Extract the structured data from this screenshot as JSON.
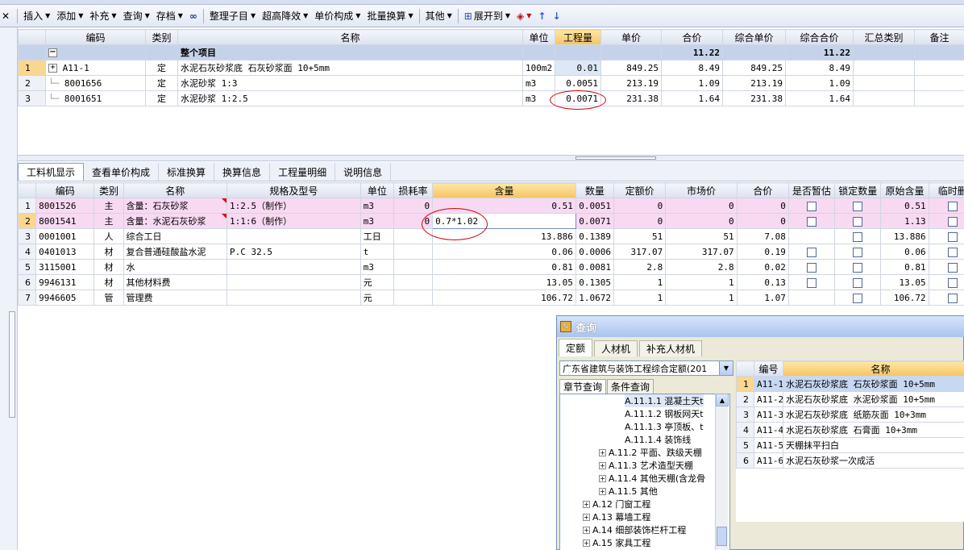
{
  "toolbar": {
    "insert": "插入",
    "add": "添加",
    "supplement": "补充",
    "query": "查询",
    "archive": "存档",
    "organize_children": "整理子目",
    "super_height": "超高降效",
    "unit_price_composition": "单价构成",
    "batch_conversion": "批量换算",
    "other": "其他",
    "expand_to": "展开到"
  },
  "upper_table": {
    "headers": [
      "编码",
      "类别",
      "名称",
      "单位",
      "工程量",
      "单价",
      "合价",
      "综合单价",
      "综合合价",
      "汇总类别",
      "备注"
    ],
    "summary_row": {
      "toggle": "−",
      "name": "整个项目",
      "total": "11.22",
      "comprehensive_total": "11.22"
    },
    "rows": [
      {
        "no": "1",
        "code": "A11-1",
        "type": "定",
        "name": "水泥石灰砂浆底 石灰砂浆面 10+5mm",
        "unit": "100m2",
        "qty": "0.01",
        "price": "849.25",
        "total": "8.49",
        "comp_price": "849.25",
        "comp_total": "8.49"
      },
      {
        "no": "2",
        "code": "8001656",
        "type": "定",
        "name": "水泥砂浆 1:3",
        "unit": "m3",
        "qty": "0.0051",
        "price": "213.19",
        "total": "1.09",
        "comp_price": "213.19",
        "comp_total": "1.09"
      },
      {
        "no": "3",
        "code": "8001651",
        "type": "定",
        "name": "水泥砂浆 1:2.5",
        "unit": "m3",
        "qty": "0.0071",
        "price": "231.38",
        "total": "1.64",
        "comp_price": "231.38",
        "comp_total": "1.64"
      }
    ]
  },
  "tabs": [
    "工料机显示",
    "查看单价构成",
    "标准换算",
    "换算信息",
    "工程量明细",
    "说明信息"
  ],
  "lower_table": {
    "headers": [
      "编码",
      "类别",
      "名称",
      "规格及型号",
      "单位",
      "损耗率",
      "含量",
      "数量",
      "定额价",
      "市场价",
      "合价",
      "是否暂估",
      "锁定数量",
      "原始含量",
      "临时删"
    ],
    "rows": [
      {
        "no": "1",
        "code": "8001526",
        "type": "主",
        "name": "含量：石灰砂浆",
        "spec": "1:2.5（制作）",
        "unit": "m3",
        "loss": "0",
        "content": "0.51",
        "qty": "0.0051",
        "quota": "0",
        "market": "0",
        "total": "0",
        "orig": "0.51"
      },
      {
        "no": "2",
        "code": "8001541",
        "type": "主",
        "name": "含量：水泥石灰砂浆",
        "spec": "1:1:6（制作）",
        "unit": "m3",
        "loss": "0",
        "content": "0.7*1.02",
        "qty": "0.0071",
        "quota": "0",
        "market": "0",
        "total": "0",
        "orig": "1.13"
      },
      {
        "no": "3",
        "code": "0001001",
        "type": "人",
        "name": "综合工日",
        "spec": "",
        "unit": "工日",
        "loss": "",
        "content": "13.886",
        "qty": "0.1389",
        "quota": "51",
        "market": "51",
        "total": "7.08",
        "orig": "13.886"
      },
      {
        "no": "4",
        "code": "0401013",
        "type": "材",
        "name": "复合普通硅酸盐水泥",
        "spec": "P.C 32.5",
        "unit": "t",
        "loss": "",
        "content": "0.06",
        "qty": "0.0006",
        "quota": "317.07",
        "market": "317.07",
        "total": "0.19",
        "orig": "0.06"
      },
      {
        "no": "5",
        "code": "3115001",
        "type": "材",
        "name": "水",
        "spec": "",
        "unit": "m3",
        "loss": "",
        "content": "0.81",
        "qty": "0.0081",
        "quota": "2.8",
        "market": "2.8",
        "total": "0.02",
        "orig": "0.81"
      },
      {
        "no": "6",
        "code": "9946131",
        "type": "材",
        "name": "其他材料费",
        "spec": "",
        "unit": "元",
        "loss": "",
        "content": "13.05",
        "qty": "0.1305",
        "quota": "1",
        "market": "1",
        "total": "0.13",
        "orig": "13.05"
      },
      {
        "no": "7",
        "code": "9946605",
        "type": "管",
        "name": "管理费",
        "spec": "",
        "unit": "元",
        "loss": "",
        "content": "106.72",
        "qty": "1.0672",
        "quota": "1",
        "market": "1",
        "total": "1.07",
        "orig": "106.72"
      }
    ]
  },
  "query": {
    "title": "查询",
    "tabs": [
      "定额",
      "人材机",
      "补充人材机"
    ],
    "combo": "广东省建筑与装饰工程综合定额(201",
    "subtabs": [
      "章节查询",
      "条件查询"
    ],
    "tree": [
      "A.11.1.1 混凝土天t",
      "A.11.1.2 钢板网天t",
      "A.11.1.3 亭顶板、t",
      "A.11.1.4 装饰线",
      "A.11.2 平面、跌级天棚",
      "A.11.3 艺术造型天棚",
      "A.11.4 其他天棚(含龙骨",
      "A.11.5 其他",
      "A.12 门窗工程",
      "A.13 幕墙工程",
      "A.14 细部装饰栏杆工程",
      "A.15 家具工程"
    ],
    "grid_headers": [
      "编号",
      "名称"
    ],
    "grid_rows": [
      {
        "no": "1",
        "code": "A11-1",
        "name": "水泥石灰砂浆底 石灰砂浆面 10+5mm"
      },
      {
        "no": "2",
        "code": "A11-2",
        "name": "水泥石灰砂浆底 水泥砂浆面 10+5mm"
      },
      {
        "no": "3",
        "code": "A11-3",
        "name": "水泥石灰砂浆底 纸筋灰面 10+3mm"
      },
      {
        "no": "4",
        "code": "A11-4",
        "name": "水泥石灰砂浆底 石膏面 10+3mm"
      },
      {
        "no": "5",
        "code": "A11-5",
        "name": "天棚抹平扫白"
      },
      {
        "no": "6",
        "code": "A11-6",
        "name": "水泥石灰砂浆一次成活"
      }
    ]
  }
}
